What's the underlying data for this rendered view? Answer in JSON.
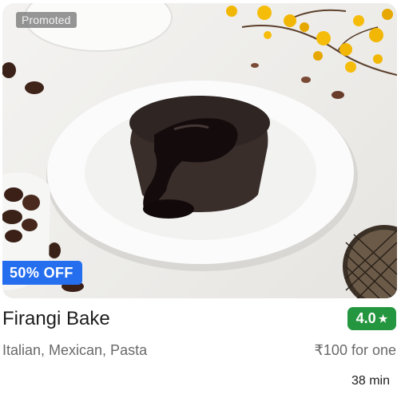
{
  "card": {
    "promoted_label": "Promoted",
    "offer_label": "50% OFF",
    "restaurant_name": "Firangi Bake",
    "rating": "4.0",
    "rating_icon": "star-icon",
    "cuisines": "Italian, Mexican, Pasta",
    "price": "₹100 for one",
    "delivery_time": "38 min"
  },
  "colors": {
    "offer_badge": "#256fef",
    "rating_badge": "#24963f",
    "title": "#1c1c1c",
    "secondary_text": "#696969"
  }
}
